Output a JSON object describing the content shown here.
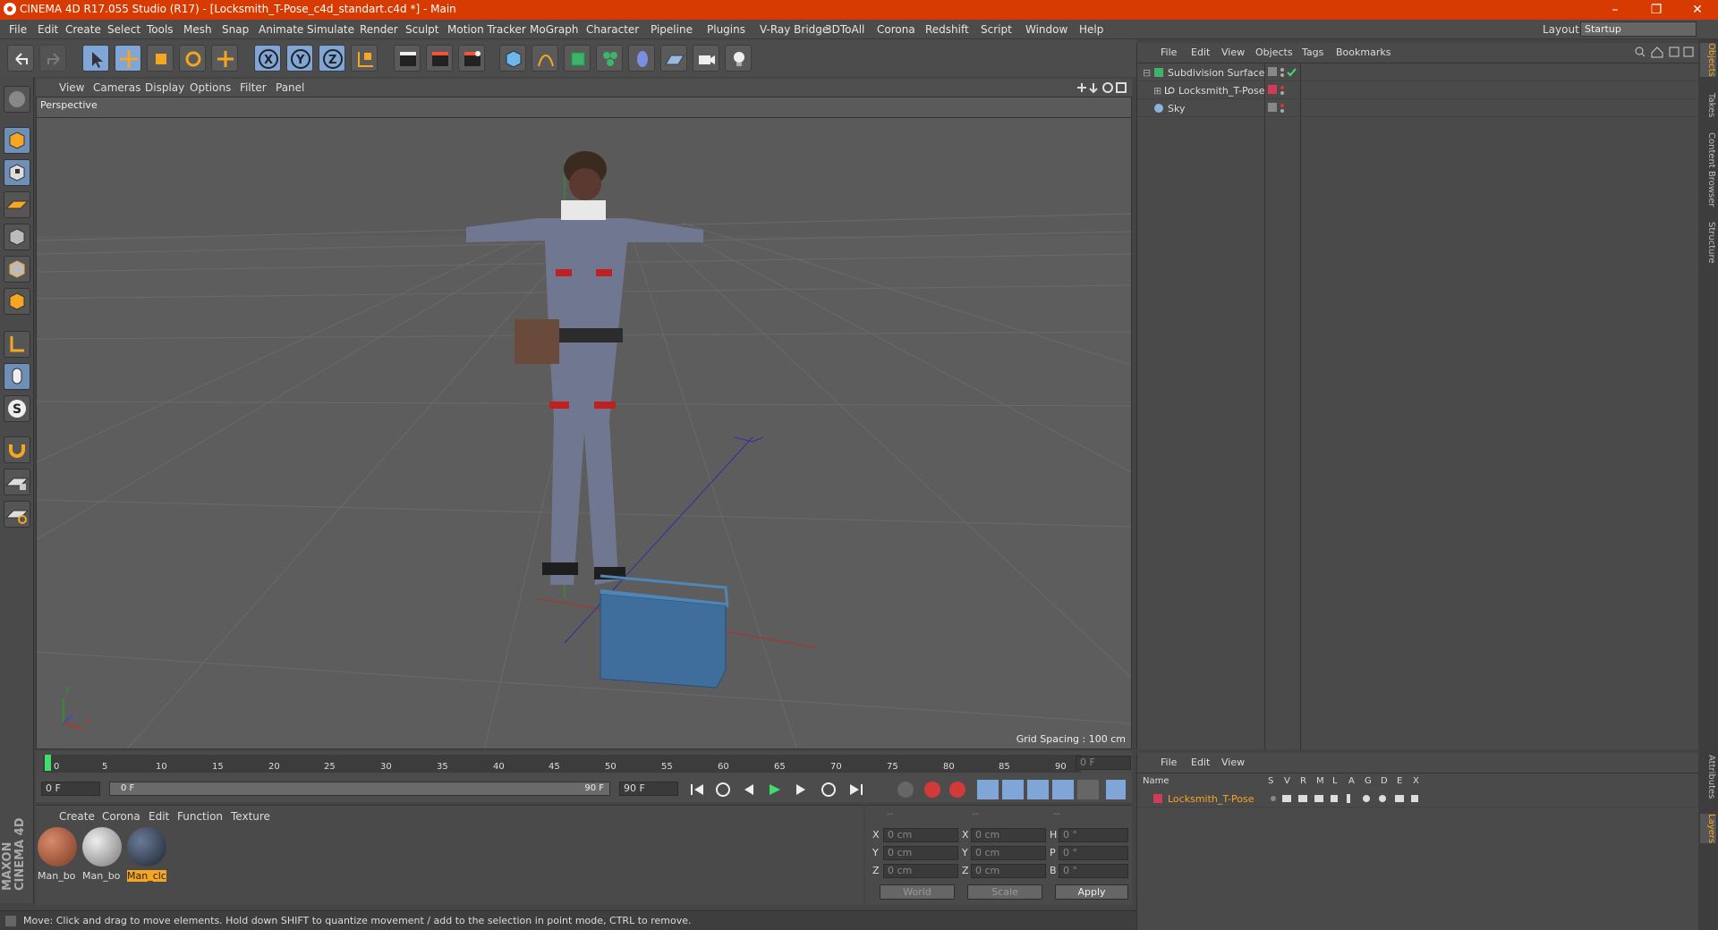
{
  "window": {
    "title": "CINEMA 4D R17.055 Studio (R17) - [Locksmith_T-Pose_c4d_standart.c4d *] - Main",
    "minimize": "–",
    "restore": "❐",
    "close": "✕"
  },
  "menu": [
    "File",
    "Edit",
    "Create",
    "Select",
    "Tools",
    "Mesh",
    "Snap",
    "Animate",
    "Simulate",
    "Render",
    "Sculpt",
    "Motion Tracker",
    "MoGraph",
    "Character",
    "Pipeline",
    "Plugins",
    "V-Ray Bridge",
    "3DToAll",
    "Corona",
    "Redshift",
    "Script",
    "Window",
    "Help"
  ],
  "layout": {
    "label": "Layout:",
    "value": "Startup"
  },
  "viewport": {
    "menu": [
      "View",
      "Cameras",
      "Display",
      "Options",
      "Filter",
      "Panel"
    ],
    "camera": "Perspective",
    "grid_spacing": "Grid Spacing : 100 cm",
    "axis_y": "y",
    "axis_x": "x"
  },
  "timeline": {
    "ticks": [
      "0",
      "5",
      "10",
      "15",
      "20",
      "25",
      "30",
      "35",
      "40",
      "45",
      "50",
      "55",
      "60",
      "65",
      "70",
      "75",
      "80",
      "85",
      "90"
    ],
    "current_frame": "0 F",
    "start": "0 F",
    "range_start": "0 F",
    "range_end": "90 F",
    "end": "90 F"
  },
  "materials": {
    "menu": [
      "Create",
      "Corona",
      "Edit",
      "Function",
      "Texture"
    ],
    "items": [
      "Man_bo",
      "Man_bo",
      "Man_clc"
    ]
  },
  "coords": {
    "headers": [
      "--",
      "--",
      "--"
    ],
    "rows": [
      {
        "a": "X",
        "av": "0 cm",
        "b": "X",
        "bv": "0 cm",
        "c": "H",
        "cv": "0 °"
      },
      {
        "a": "Y",
        "av": "0 cm",
        "b": "Y",
        "bv": "0 cm",
        "c": "P",
        "cv": "0 °"
      },
      {
        "a": "Z",
        "av": "0 cm",
        "b": "Z",
        "bv": "0 cm",
        "c": "B",
        "cv": "0 °"
      }
    ],
    "world": "World",
    "scale": "Scale",
    "apply": "Apply"
  },
  "objects": {
    "menu": [
      "File",
      "Edit",
      "View",
      "Objects",
      "Tags",
      "Bookmarks"
    ],
    "items": [
      "Subdivision Surface",
      "Locksmith_T-Pose",
      "Sky"
    ]
  },
  "layers": {
    "menu": [
      "File",
      "Edit",
      "View"
    ],
    "columns": [
      "Name",
      "S",
      "V",
      "R",
      "M",
      "L",
      "A",
      "G",
      "D",
      "E",
      "X"
    ],
    "items": [
      "Locksmith_T-Pose"
    ]
  },
  "right_tabs": [
    "Objects",
    "Takes",
    "Content Browser",
    "Structure",
    "Attributes",
    "Layers"
  ],
  "branding": "MAXON CINEMA 4D",
  "status": "Move: Click and drag to move elements. Hold down SHIFT to quantize movement / add to the selection in point mode, CTRL to remove.",
  "colors": {
    "titlebar": "#d83b01",
    "active": "#7fa6d6",
    "highlight": "#f5a623"
  }
}
